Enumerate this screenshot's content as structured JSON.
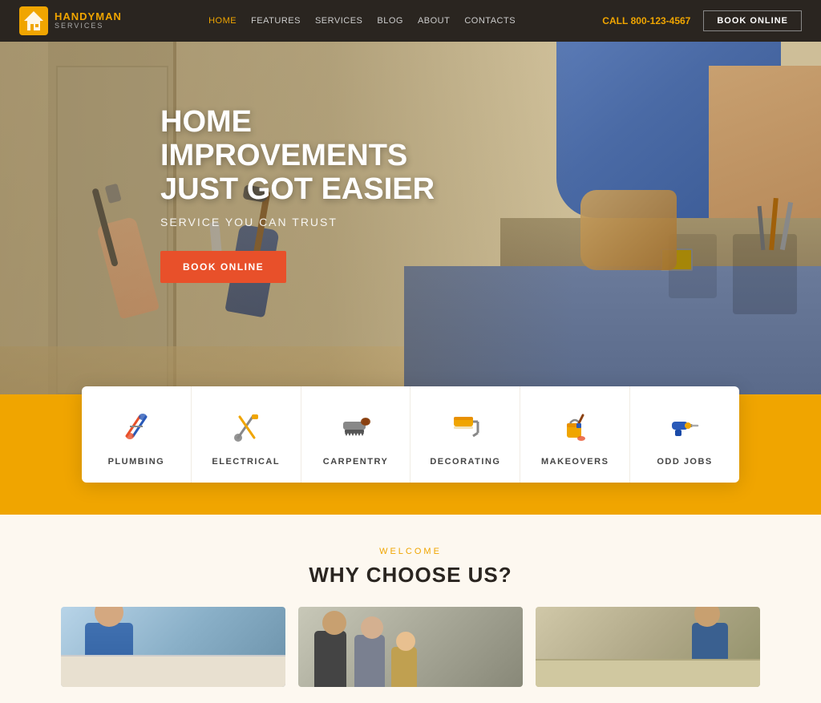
{
  "header": {
    "logo": {
      "brand_part1": "HANDY",
      "brand_part2": "MAN",
      "brand_sub": "SERVICES"
    },
    "nav_links": [
      {
        "id": "home",
        "label": "HOME",
        "active": true
      },
      {
        "id": "features",
        "label": "FEATURES",
        "active": false
      },
      {
        "id": "services",
        "label": "SERVICES",
        "active": false
      },
      {
        "id": "blog",
        "label": "BLOG",
        "active": false
      },
      {
        "id": "about",
        "label": "ABOUT",
        "active": false
      },
      {
        "id": "contacts",
        "label": "CONTACTS",
        "active": false
      }
    ],
    "call_label": "CALL",
    "call_number": "800-123-4567",
    "book_button": "BOOK ONLINE"
  },
  "hero": {
    "title_line1": "HOME IMPROVEMENTS",
    "title_line2": "JUST GOT EASIER",
    "subtitle": "SERVICE YOU CAN TRUST",
    "book_button": "BOOK ONLINE"
  },
  "services": {
    "items": [
      {
        "id": "plumbing",
        "label": "PLUMBING"
      },
      {
        "id": "electrical",
        "label": "ELECTRICAL"
      },
      {
        "id": "carpentry",
        "label": "CARPENTRY"
      },
      {
        "id": "decorating",
        "label": "DECORATING"
      },
      {
        "id": "makeovers",
        "label": "MAKEOVERS"
      },
      {
        "id": "odd-jobs",
        "label": "ODD JOBS"
      }
    ]
  },
  "why_section": {
    "welcome_label": "Welcome",
    "title": "WHY CHOOSE US?"
  },
  "colors": {
    "brand_orange": "#f0a500",
    "brand_dark": "#2a2520",
    "cta_red": "#e8502a",
    "text_dark": "#2a2520"
  }
}
